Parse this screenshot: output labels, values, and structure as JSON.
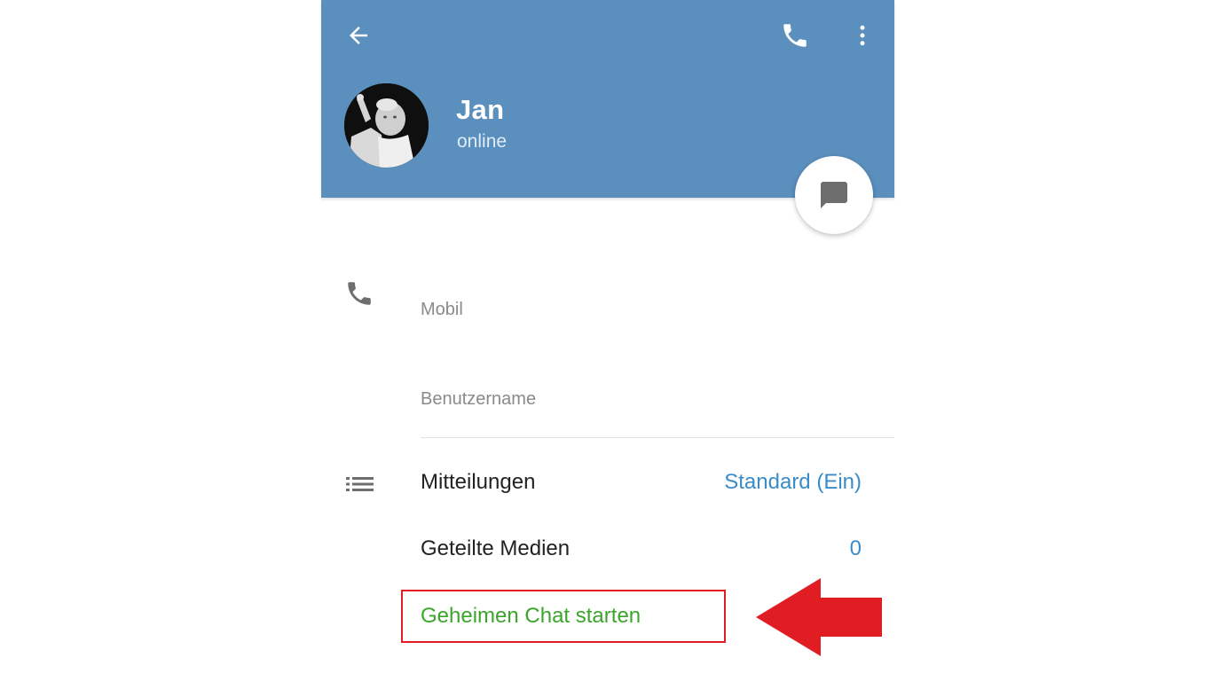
{
  "header": {
    "name": "Jan",
    "status": "online",
    "background_color": "#5b8fbd",
    "icons": {
      "back": "arrow-left-icon",
      "call": "phone-icon",
      "menu": "more-vertical-icon",
      "fab": "chat-bubble-icon"
    }
  },
  "info": {
    "phone_label": "Mobil",
    "username_label": "Benutzername"
  },
  "settings": {
    "notifications_label": "Mitteilungen",
    "notifications_value": "Standard (Ein)",
    "shared_media_label": "Geteilte Medien",
    "shared_media_value": "0",
    "secret_chat_label": "Geheimen Chat starten"
  },
  "annotation": {
    "highlight_color": "#e11d24"
  }
}
